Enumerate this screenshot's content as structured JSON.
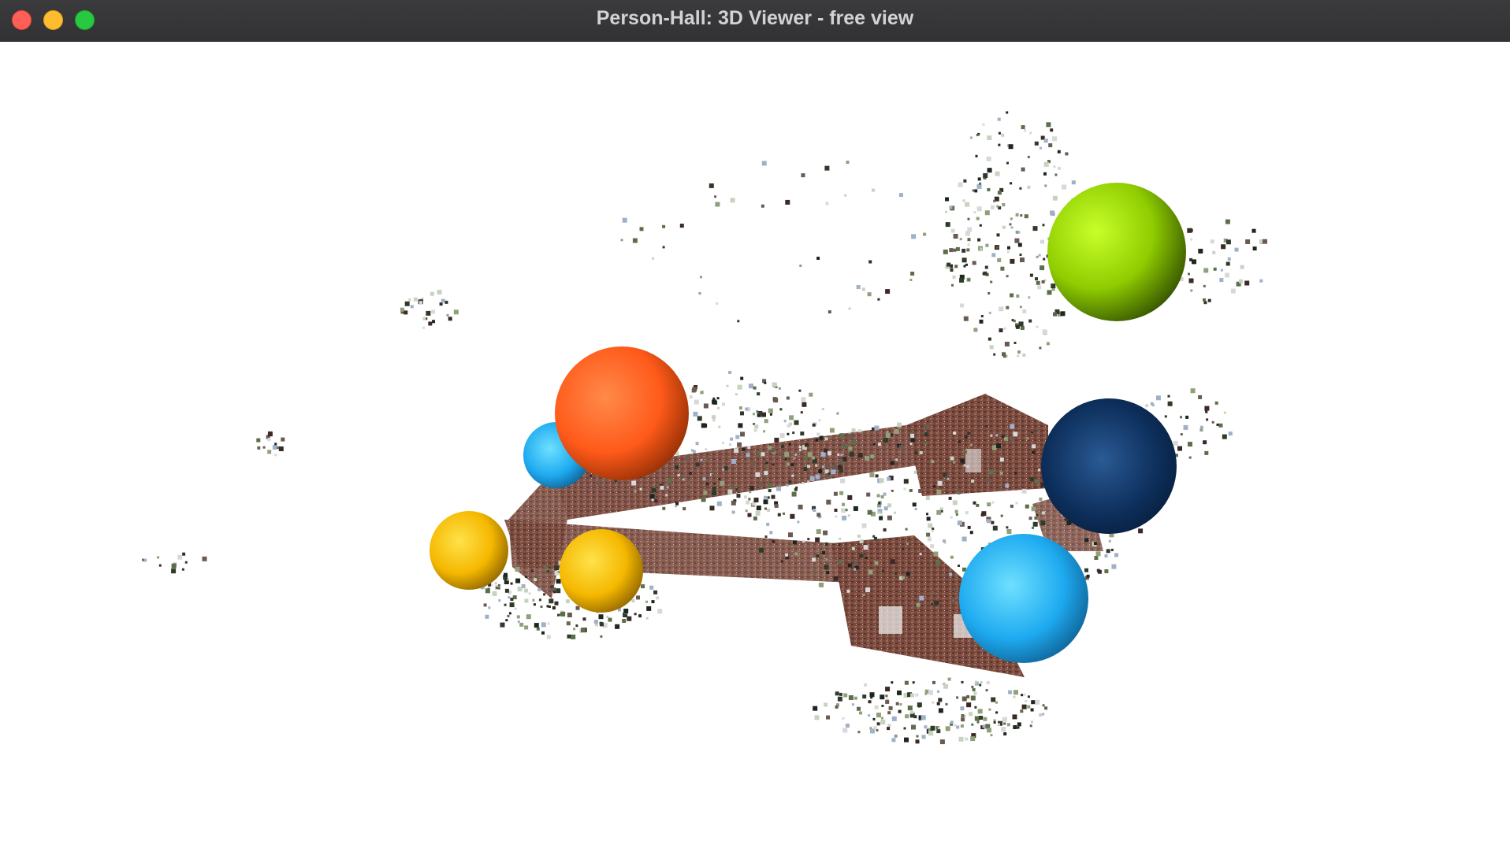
{
  "window": {
    "title": "Person-Hall: 3D Viewer - free view"
  },
  "viewport": {
    "background": "#ffffff",
    "camera_spheres": [
      {
        "name": "lime",
        "color": "#9acd00"
      },
      {
        "name": "orange",
        "color": "#ff5a1a"
      },
      {
        "name": "light-blue-small",
        "color": "#1eb4f0"
      },
      {
        "name": "navy",
        "color": "#0d2f5c"
      },
      {
        "name": "light-blue-large",
        "color": "#1eaaf0"
      },
      {
        "name": "yellow-left",
        "color": "#f5b800"
      },
      {
        "name": "yellow-right",
        "color": "#f5b800"
      }
    ]
  }
}
